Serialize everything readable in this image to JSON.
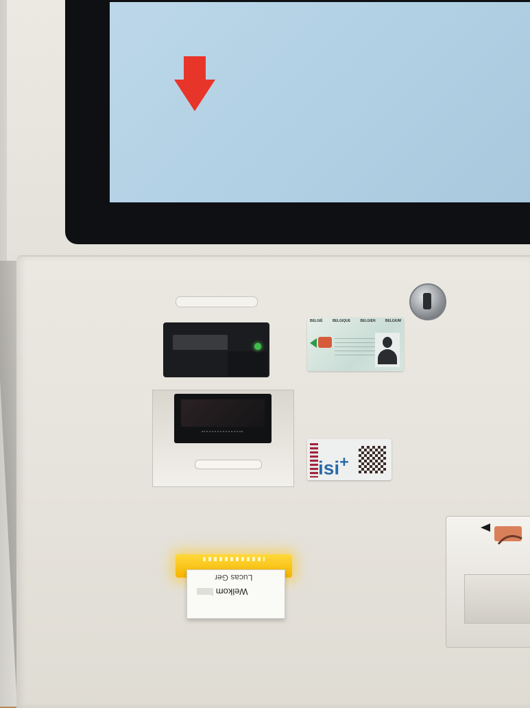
{
  "ticket": {
    "line1": "Welkom in",
    "line2": "Lucas Ger"
  },
  "id_card": {
    "headers": [
      "BELGIË",
      "BELGIQUE",
      "BELGIEN",
      "BELGIUM"
    ]
  },
  "isi_card": {
    "brand": "isi",
    "plus": "+"
  },
  "colors": {
    "arrow": "#e8352a",
    "screen": "#b4d2e6",
    "glow": "#ffd23a",
    "led": "#3fbf4a"
  },
  "icons": [
    "down-arrow-icon",
    "lock-icon",
    "card-slot-icon",
    "hand-card-icon"
  ]
}
